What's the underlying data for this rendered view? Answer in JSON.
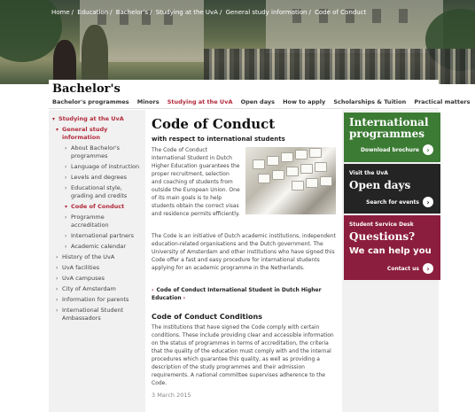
{
  "breadcrumb": [
    "Home",
    "/",
    "Education",
    "/",
    "Bachelor's",
    "/",
    "Studying at the UvA",
    "/",
    "General study information",
    "/",
    "Code of Conduct"
  ],
  "header": {
    "title": "Bachelor's",
    "nav": [
      "Bachelor's programmes",
      "Minors",
      "Studying at the UvA",
      "Open days",
      "How to apply",
      "Scholarships & Tuition",
      "Practical matters"
    ]
  },
  "sidebar": {
    "items": [
      "Studying at the UvA",
      "General study information",
      "About Bachelor's programmes",
      "Language of instruction",
      "Levels and degrees",
      "Educational style, grading and credits",
      "Code of Conduct",
      "Programme accreditation",
      "International partners",
      "Academic calendar",
      "History of the UvA",
      "UvA facilities",
      "UvA campuses",
      "City of Amsterdam",
      "Information for parents",
      "International Student Ambassadors"
    ]
  },
  "content": {
    "title": "Code of Conduct",
    "subtitle": "with respect to international students",
    "intro": "The Code of Conduct International Student in Dutch Higher Education guarantees the proper recruitment, selection and coaching of students from outside the European Union. One of its main goals is to help students obtain the correct visas and residence permits efficiently.",
    "para2": "The Code is an initiative of Dutch academic institutions, independent education-related organisations and the Dutch government. The University of Amsterdam and other institutions who have signed this Code offer a fast and easy procedure for international students applying for an academic programme in the Netherlands.",
    "link": "Code of Conduct International Student in Dutch Higher Education",
    "h2": "Code of Conduct Conditions",
    "para3": "The institutions that have signed the Code comply with certain conditions. These include providing clear and accessible information on the status of programmes in terms of accreditation, the criteria that the quality of the education must comply with and the internal procedures which guarantee this quality, as well as providing a description of the study programmes and their admission requirements. A national committee supervises adherence to the Code.",
    "date": "3 March 2015"
  },
  "right": {
    "intl_title": "International programmes",
    "intl_cta": "Download brochure",
    "open_small": "Visit the UvA",
    "open_title": "Open days",
    "open_cta": "Search for events",
    "q_small": "Student Service Desk",
    "q_title": "Questions?",
    "q_help": "We can help you",
    "q_cta": "Contact us"
  },
  "colors": {
    "accent_red": "#b22a3a",
    "green": "#3c7b34",
    "dark": "#242424",
    "crimson": "#8b1d3e"
  }
}
